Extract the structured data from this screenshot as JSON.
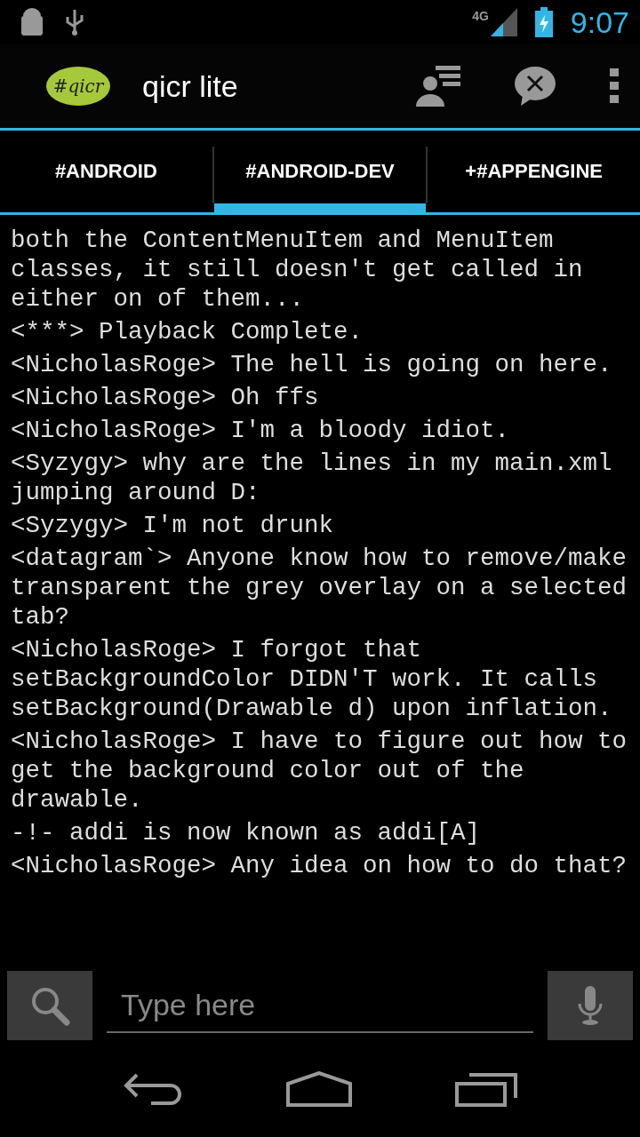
{
  "status_bar": {
    "network": "4G",
    "time": "9:07"
  },
  "action_bar": {
    "logo": "#qicr",
    "title": "qicr lite"
  },
  "tabs": [
    {
      "label": "#ANDROID",
      "selected": false
    },
    {
      "label": "#ANDROID-DEV",
      "selected": true
    },
    {
      "label": "+#APPENGINE",
      "selected": false
    }
  ],
  "messages": [
    "both the ContentMenuItem and MenuItem classes, it still doesn't get called in either on of them...",
    "<***> Playback Complete.",
    "<NicholasRoge> The hell is going on here.",
    "<NicholasRoge> Oh ffs",
    "<NicholasRoge> I'm a bloody idiot.",
    "<Syzygy> why are the lines in my main.xml jumping around D:",
    "<Syzygy> I'm not drunk",
    "<datagram`> Anyone know how to remove/make transparent the grey overlay on a selected tab?",
    "<NicholasRoge> I forgot that setBackgroundColor DIDN'T work. It calls setBackground(Drawable d) upon inflation.",
    "<NicholasRoge> I have to figure out how to get the background color out of the drawable.",
    "-!- addi is now known as addi[A]",
    "<NicholasRoge> Any idea on how to do that?"
  ],
  "input": {
    "placeholder": "Type here"
  }
}
